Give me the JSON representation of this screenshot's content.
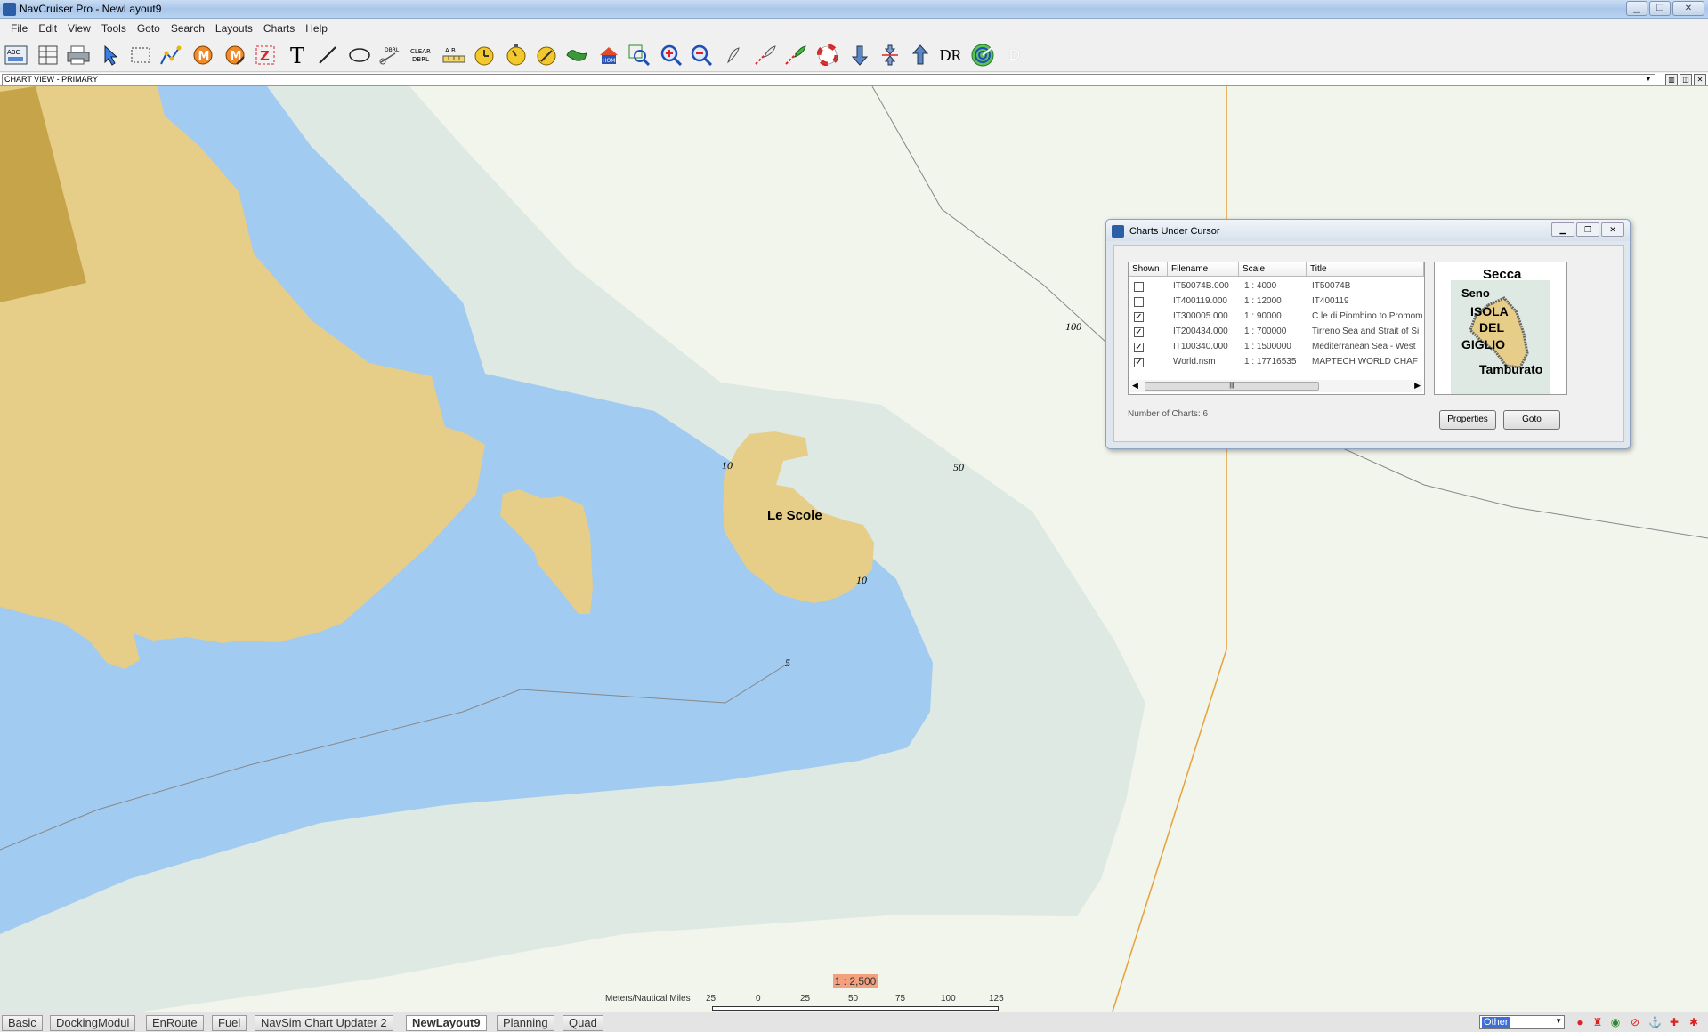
{
  "window": {
    "title": "NavCruiser Pro - NewLayout9"
  },
  "menu": [
    "File",
    "Edit",
    "View",
    "Tools",
    "Goto",
    "Search",
    "Layouts",
    "Charts",
    "Help"
  ],
  "toolbar": {
    "dr_label": "DR",
    "d_label": "D",
    "dbl_label": "DBRL",
    "clear_label": "CLEAR DBRL",
    "home_label": "HOME",
    "ab_label": "A B"
  },
  "view": {
    "combo_value": "CHART VIEW - PRIMARY"
  },
  "map": {
    "depths": [
      "100",
      "50",
      "10",
      "10",
      "5"
    ],
    "place_name": "Le Scole",
    "scale_ratio": "1 : 2,500",
    "scale_unit_label": "Meters/Nautical Miles",
    "scale_ticks": [
      "25",
      "0",
      "25",
      "50",
      "75",
      "100",
      "125"
    ],
    "colors": {
      "land": "#e6cd88",
      "shallow": "#a1cbf0",
      "medium": "#dde9e2",
      "deep": "#f1f5ec",
      "contour_orange": "#e8a13a"
    }
  },
  "dialog": {
    "title": "Charts Under Cursor",
    "columns": [
      "Shown",
      "Filename",
      "Scale",
      "Title"
    ],
    "rows": [
      {
        "shown": false,
        "filename": "IT50074B.000",
        "scale": "1 : 4000",
        "title": "IT50074B"
      },
      {
        "shown": false,
        "filename": "IT400119.000",
        "scale": "1 : 12000",
        "title": "IT400119"
      },
      {
        "shown": true,
        "filename": "IT300005.000",
        "scale": "1 : 90000",
        "title": "C.le di Piombino to Promom"
      },
      {
        "shown": true,
        "filename": "IT200434.000",
        "scale": "1 : 700000",
        "title": "Tirreno Sea and Strait of Si"
      },
      {
        "shown": true,
        "filename": "IT100340.000",
        "scale": "1 : 1500000",
        "title": "Mediterranean Sea - West"
      },
      {
        "shown": true,
        "filename": "World.nsm",
        "scale": "1 : 17716535",
        "title": "MAPTECH WORLD CHAF"
      }
    ],
    "count_label": "Number of Charts:  6",
    "properties_label": "Properties",
    "goto_label": "Goto",
    "scroll_thumb": "|||",
    "preview_labels": {
      "top": "Secca",
      "left": "Seno",
      "island1": "ISOLA",
      "island2": "DEL",
      "island3": "GIGLIO",
      "bottom": "Tamburato"
    }
  },
  "tabs": [
    "Basic",
    "DockingModul",
    "EnRoute",
    "Fuel",
    "NavSim Chart Updater 2",
    "NewLayout9",
    "Planning",
    "Quad"
  ],
  "active_tab": "NewLayout9",
  "status": {
    "combo_value": "Other"
  }
}
